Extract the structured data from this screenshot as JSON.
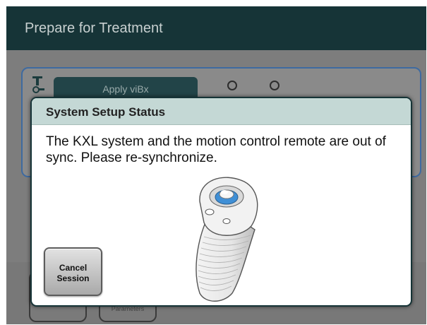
{
  "header": {
    "title": "Prepare for Treatment"
  },
  "background": {
    "apply_button_label": "Apply viBx",
    "bottom_left_label": "",
    "bottom_right_label": "Parameters"
  },
  "dialog": {
    "title": "System Setup Status",
    "message": "The KXL system and the motion control remote are out of sync. Please re-synchronize.",
    "cancel_label": "Cancel\nSession"
  },
  "colors": {
    "header_bg": "#163437",
    "dialog_titlebar": "#c4d8d5",
    "panel_border": "#3e6aa0",
    "remote_accent": "#3f8fd6"
  },
  "icons": [
    "step-person-icon",
    "motion-remote-illustration"
  ]
}
